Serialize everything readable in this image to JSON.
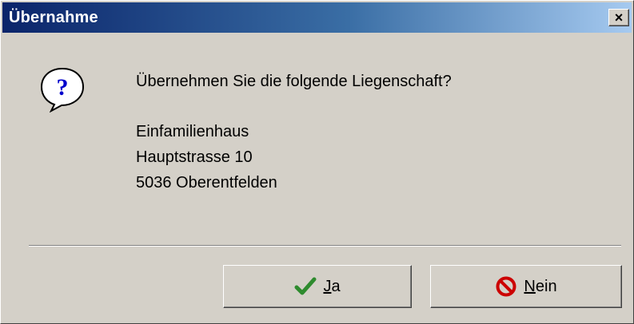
{
  "window": {
    "title": "Übernahme",
    "close_label": "×"
  },
  "dialog": {
    "icon": "question-icon",
    "prompt": "Übernehmen Sie die folgende Liegenschaft?",
    "details": [
      "Einfamilienhaus",
      "Hauptstrasse 10",
      "5036 Oberentfelden"
    ]
  },
  "buttons": {
    "yes": {
      "mnemonic": "J",
      "rest": "a",
      "icon": "check-icon"
    },
    "no": {
      "mnemonic": "N",
      "rest": "ein",
      "icon": "no-entry-icon"
    }
  },
  "colors": {
    "face": "#d4d0c8",
    "title_start": "#0a246a",
    "title_end": "#a6caf0",
    "check": "#2e8b2e",
    "no_entry": "#cc0000"
  }
}
